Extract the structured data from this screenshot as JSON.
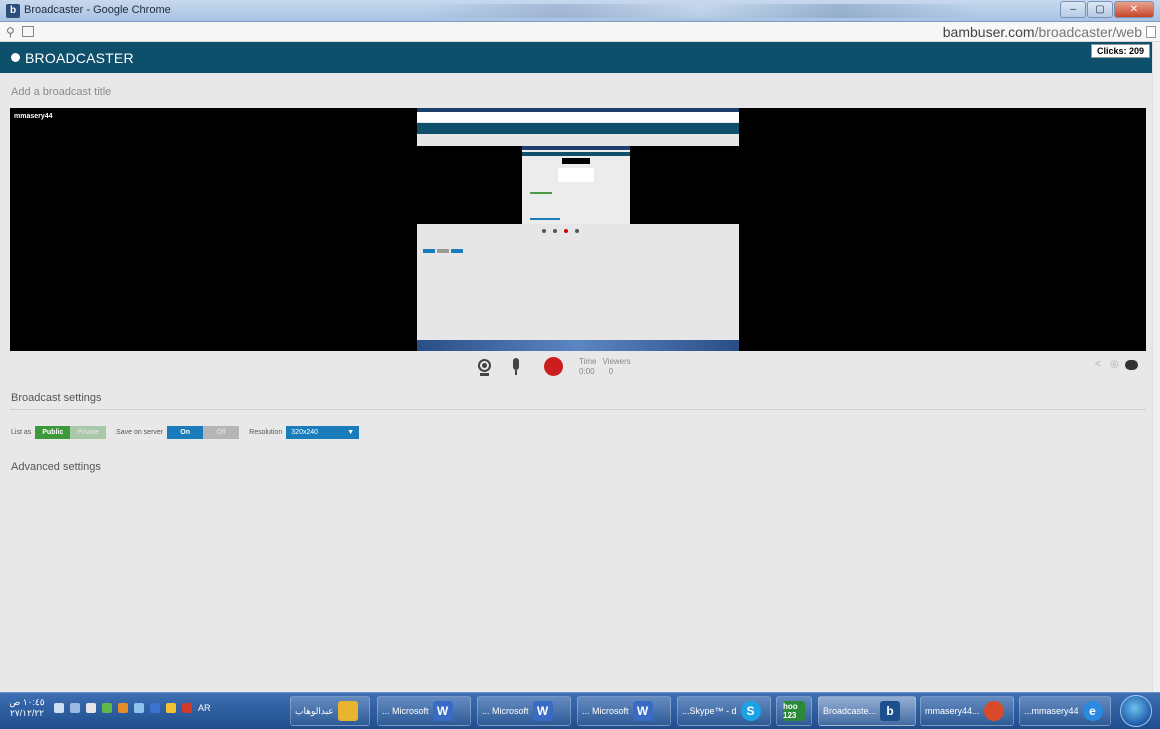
{
  "window": {
    "title": "Broadcaster - Google Chrome",
    "app_icon_letter": "b"
  },
  "address": {
    "host": "bambuser.com",
    "path": "/broadcaster/web"
  },
  "header": {
    "brand": "BROADCASTER",
    "clicks": "Clicks: 209"
  },
  "broadcast": {
    "title_placeholder": "Add a broadcast title",
    "username": "mmasery44"
  },
  "controls": {
    "time_label": "Time",
    "viewers_label": "Viewers",
    "time_value": "0:00",
    "viewers_value": "0"
  },
  "settings": {
    "title": "Broadcast settings",
    "list_as_label": "List as",
    "public_label": "Public",
    "private_label": "Private",
    "save_label": "Save on server",
    "on_label": "On",
    "off_label": "Off",
    "resolution_label": "Resolution",
    "resolution_value": "320x240",
    "advanced_title": "Advanced settings"
  },
  "taskbar": {
    "clock_time": "١٠:٤٥ ص",
    "clock_date": "٢٧/١٢/٢٢",
    "lang": "AR",
    "items": [
      {
        "label": "عبدالوهاب",
        "icon": "folder-icon",
        "color": "#e8b430"
      },
      {
        "label": "... Microsoft",
        "icon": "word-icon",
        "color": "#3a6bc4"
      },
      {
        "label": "... Microsoft",
        "icon": "word-icon",
        "color": "#3a6bc4"
      },
      {
        "label": "... Microsoft",
        "icon": "word-icon",
        "color": "#3a6bc4"
      },
      {
        "label": "...Skype™ - d",
        "icon": "skype-icon",
        "color": "#1aa3e6"
      },
      {
        "label": "hoo 123",
        "icon": "hoo-icon",
        "color": "#2a8a3a"
      },
      {
        "label": "Broadcaste...",
        "icon": "bambuser-icon",
        "color": "#1c4f8c"
      },
      {
        "label": "mmasery44...",
        "icon": "chrome-icon",
        "color": "#d94a2b"
      },
      {
        "label": "...mmasery44",
        "icon": "ie-icon",
        "color": "#2a8ae0"
      }
    ]
  }
}
